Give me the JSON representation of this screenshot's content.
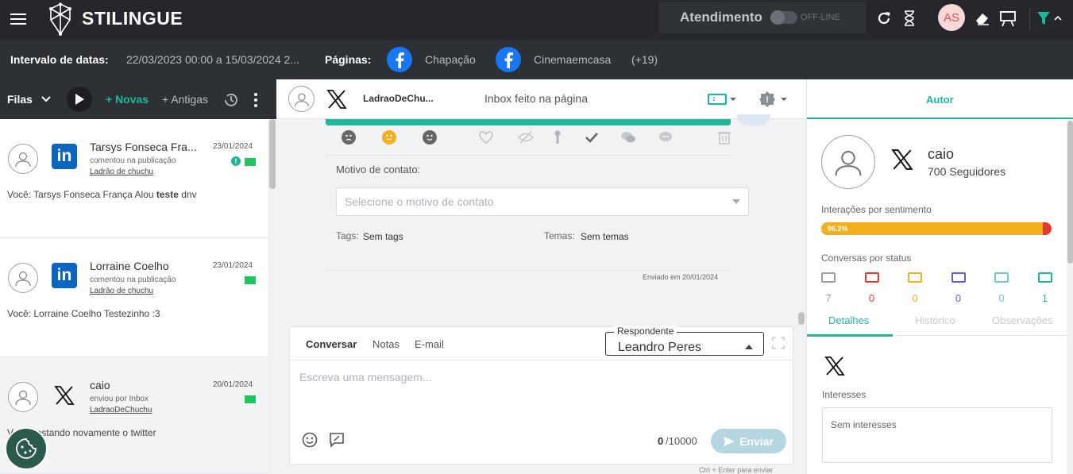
{
  "topbar": {
    "brand": "STILINGUE",
    "atendimento_label": "Atendimento",
    "status_label": "OFF-LINE",
    "avatar_initials": "AS",
    "accent": "#21b69a"
  },
  "filters": {
    "date_label": "Intervalo de datas:",
    "date_value": "22/03/2023 00:00 a 15/03/2024 2...",
    "pages_label": "Páginas:",
    "pages": [
      "Chapação",
      "Cinemaemcasa"
    ],
    "more_pages": "(+19)"
  },
  "queue": {
    "title": "Filas",
    "new_label": "+ Novas",
    "old_label": "+ Antigas",
    "conversations": [
      {
        "name": "Tarsys Fonseca Fra...",
        "date": "23/01/2024",
        "action": "comentou na publicação",
        "target": "Ladrão de chuchu",
        "message_prefix": "Você: Tarsys Fonseca França Alou ",
        "message_bold": "teste",
        "message_suffix": " dnv",
        "network": "linkedin"
      },
      {
        "name": "Lorraine Coelho",
        "date": "23/01/2024",
        "action": "comentou na publicação",
        "target": "Ladrão de chuchu",
        "message": "Você: Lorraine Coelho Testezinho :3",
        "network": "linkedin"
      },
      {
        "name": "caio",
        "date": "20/01/2024",
        "action": "enviou por Inbox",
        "target": "LadraoDeChuchu",
        "message": "Você: testando novamente o twitter",
        "network": "x"
      }
    ]
  },
  "conversation": {
    "account": "LadraoDeChu...",
    "context": "Inbox feito na página",
    "contact_reason_label": "Motivo de contato:",
    "contact_reason_placeholder": "Selecione o motivo de contato",
    "tags_label": "Tags:",
    "tags_value": "Sem tags",
    "themes_label": "Temas:",
    "themes_value": "Sem temas",
    "sent_at": "Enviado em 20/01/2024",
    "progress_color": "#21b69a"
  },
  "composer": {
    "tabs": [
      "Conversar",
      "Notas",
      "E-mail"
    ],
    "respondent_label": "Respondente",
    "respondent_value": "Leandro Peres",
    "placeholder": "Escreva uma mensagem...",
    "char_count": "0",
    "char_max": "/10000",
    "send_label": "Enviar",
    "hint": "Ctrl + Enter para enviar"
  },
  "author": {
    "tab": "Autor",
    "name": "caio",
    "followers": "700 Seguidores",
    "sentiment_label": "Interações por sentimento",
    "sentiment_percent": "96.2%",
    "sentiment_fraction": 0.962,
    "status_label": "Conversas por status",
    "statuses": [
      {
        "count": "7",
        "color": "#9aa0a6"
      },
      {
        "count": "0",
        "color": "#e53935"
      },
      {
        "count": "0",
        "color": "#f2b01e"
      },
      {
        "count": "0",
        "color": "#6a5acd"
      },
      {
        "count": "0",
        "color": "#6ec6d8"
      },
      {
        "count": "1",
        "color": "#21b69a"
      }
    ],
    "subtabs": [
      "Detalhes",
      "Histórico",
      "Observações"
    ],
    "interests_label": "Interesses",
    "interests_value": "Sem interesses"
  }
}
